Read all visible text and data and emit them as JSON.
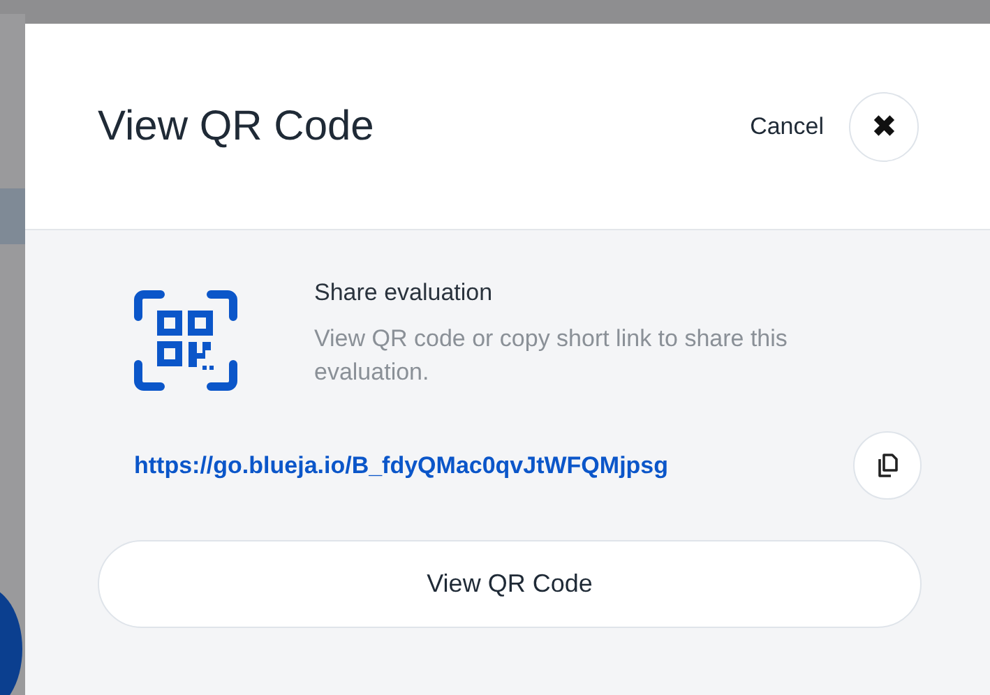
{
  "dialog": {
    "title": "View QR Code",
    "cancel": "Cancel",
    "close_symbol": "✖"
  },
  "share": {
    "heading": "Share evaluation",
    "description": "View QR code or copy short link to share this evaluation.",
    "link": "https://go.blueja.io/B_fdyQMac0qvJtWFQMjpsg"
  },
  "button": "View QR Code"
}
